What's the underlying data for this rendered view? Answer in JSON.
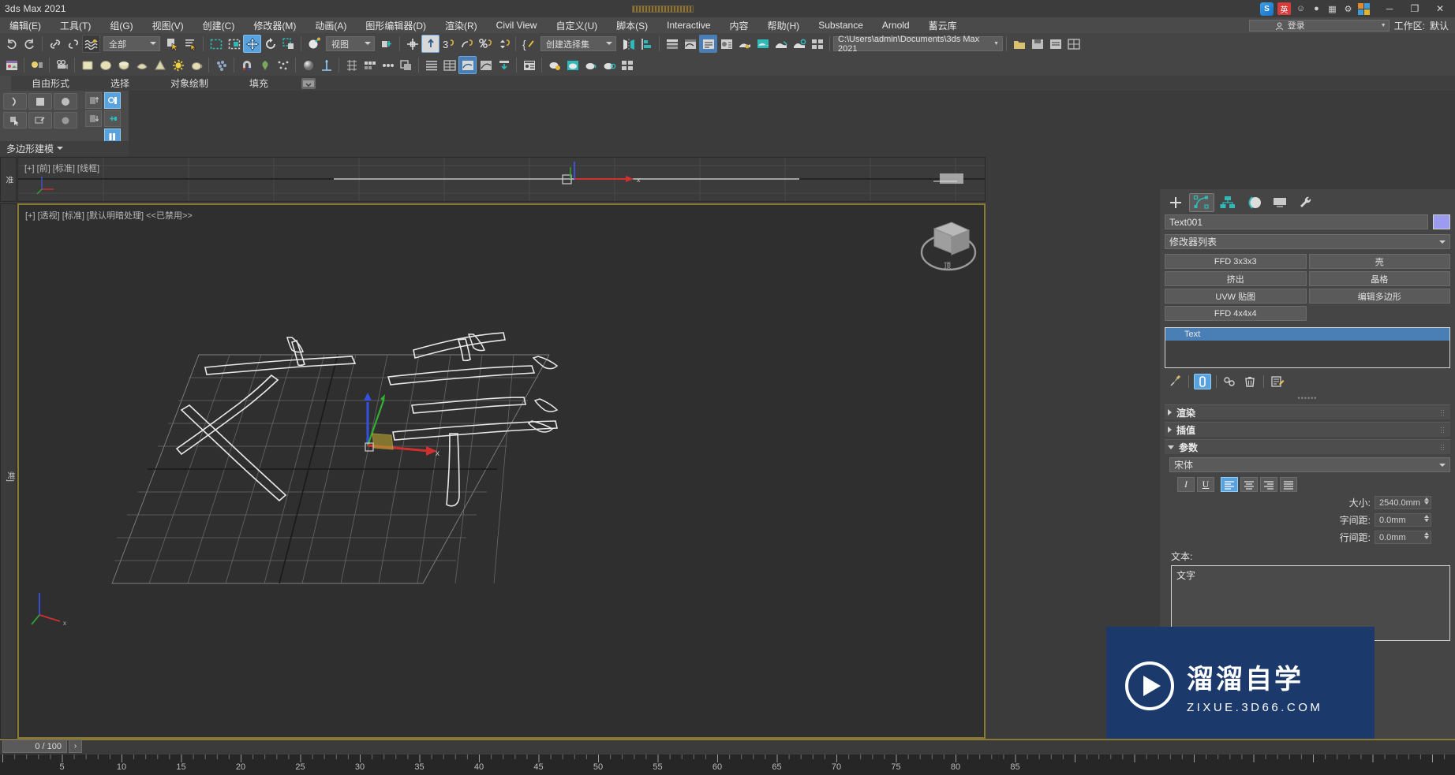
{
  "titlebar": {
    "app_title": "3ds Max 2021",
    "minimize": "─",
    "maximize": "❐",
    "close": "✕",
    "tray_logo": "S",
    "tray_ime": "英",
    "tray_icons": [
      "smiley-icon",
      "mic-icon",
      "keyboard-icon",
      "apps-grid-icon"
    ]
  },
  "menubar": {
    "items": [
      "编辑(E)",
      "工具(T)",
      "组(G)",
      "视图(V)",
      "创建(C)",
      "修改器(M)",
      "动画(A)",
      "图形编辑器(D)",
      "渲染(R)",
      "Civil View",
      "自定义(U)",
      "脚本(S)",
      "Interactive",
      "内容",
      "帮助(H)",
      "Substance",
      "Arnold",
      "蓄云库"
    ],
    "login_label": "登录",
    "workspace_label": "工作区:",
    "workspace_value": "默认"
  },
  "toolbar1": {
    "selection_filter": "全部",
    "reference_coord": "视图",
    "named_selection": "创建选择集",
    "project_path": "C:\\Users\\admin\\Documents\\3ds Max 2021",
    "icons": [
      "undo-icon",
      "redo-icon",
      "select-link-icon",
      "unlink-icon",
      "bind-space-warp-icon",
      "select-object-icon",
      "select-by-name-icon",
      "rect-selection-region-icon",
      "window-crossing-icon",
      "select-and-move-icon",
      "select-and-rotate-icon",
      "select-and-scale-icon",
      "placement-icon",
      "use-pivot-center-icon",
      "select-and-manipulate-icon",
      "snap-toggle-icon",
      "angle-snap-icon",
      "percent-snap-icon",
      "spinner-snap-icon",
      "edit-named-selection-icon",
      "mirror-icon",
      "align-icon",
      "layer-explorer-icon",
      "curve-editor-icon",
      "schematic-view-icon",
      "material-editor-icon",
      "render-setup-icon",
      "render-frame-window-icon",
      "render-production-icon",
      "render-iterative-icon",
      "activeshade-icon",
      "project-folder-icon"
    ]
  },
  "toolbar2": {
    "icons": [
      "asset-tracking-icon",
      "light-icon",
      "camera-icon",
      "box-icon",
      "sphere-icon",
      "cylinder-icon",
      "torus-icon",
      "cone-icon",
      "sunlight-icon",
      "teapot-icon",
      "scatter-icon",
      "particle-icon",
      "magnet-icon",
      "foliage-icon",
      "material-sphere-icon",
      "move-gizmo-icon",
      "align-grid-icon",
      "array-icon",
      "spacing-tool-icon",
      "clone-icon",
      "snapshot-icon",
      "list-view-icon",
      "table-view-icon",
      "graph-icon",
      "curve-icon",
      "export-icon",
      "import-icon",
      "dope-sheet-icon",
      "teapot-gear-icon",
      "teapot-cyan-icon",
      "teapot-plain-icon",
      "teapot-outline-icon",
      "quad-layout-icon"
    ]
  },
  "ribbon": {
    "tabs": [
      "自由形式",
      "选择",
      "对象绘制",
      "填充"
    ],
    "panel_title": "多边形建模",
    "panel_icons": [
      "arc-shape-icon",
      "square-shape-icon",
      "sphere-shape-icon",
      "cursor-select-icon",
      "object-paint-icon",
      "circle-icon",
      "push-up-icon",
      "push-down-icon",
      "highlight-icon",
      "pin-icon",
      "columns-icon"
    ]
  },
  "viewports": {
    "top_label": "[+] [前] [标准] [线框]",
    "main_label": "[+] [透视] [标准] [默认明暗处理] <<已禁用>>",
    "left_tab_top": "准",
    "left_tab_main": "准]",
    "viewcube_label": "顶"
  },
  "command_panel": {
    "tabs": [
      {
        "name": "create-tab",
        "icon": "plus-icon"
      },
      {
        "name": "modify-tab",
        "icon": "modify-icon"
      },
      {
        "name": "hierarchy-tab",
        "icon": "hierarchy-icon"
      },
      {
        "name": "motion-tab",
        "icon": "motion-icon"
      },
      {
        "name": "display-tab",
        "icon": "display-icon"
      },
      {
        "name": "utilities-tab",
        "icon": "wrench-icon"
      }
    ],
    "object_name": "Text001",
    "object_color": "#9b9bf0",
    "modifier_list_label": "修改器列表",
    "modifier_buttons": [
      "FFD 3x3x3",
      "壳",
      "挤出",
      "晶格",
      "UVW 贴图",
      "编辑多边形",
      "FFD 4x4x4"
    ],
    "stack_items": [
      "Text"
    ],
    "stack_tools": [
      "pin-stack-icon",
      "show-end-result-icon",
      "make-unique-icon",
      "remove-modifier-icon",
      "configure-sets-icon"
    ],
    "rollouts": [
      {
        "label": "渲染",
        "expanded": false
      },
      {
        "label": "插值",
        "expanded": false
      },
      {
        "label": "参数",
        "expanded": true
      }
    ],
    "parameters": {
      "font": "宋体",
      "style_buttons": [
        "I",
        "U"
      ],
      "align_buttons": [
        "align-left-icon",
        "align-center-icon",
        "align-right-icon",
        "align-justify-icon"
      ],
      "align_active": "align-left-icon",
      "size_label": "大小:",
      "size_value": "2540.0mm",
      "kerning_label": "字间距:",
      "kerning_value": "0.0mm",
      "leading_label": "行间距:",
      "leading_value": "0.0mm",
      "text_label": "文本:",
      "text_value": "文字"
    }
  },
  "watermark": {
    "title": "溜溜自学",
    "subtitle": "ZIXUE.3D66.COM",
    "accent": "#1b3a6b"
  },
  "timeline": {
    "frame_value": "0 / 100",
    "next_frame": "›",
    "tick_labels": [
      "5",
      "10",
      "15",
      "20",
      "25",
      "30",
      "35",
      "40",
      "45",
      "50",
      "55",
      "60",
      "65",
      "70",
      "75",
      "80",
      "85"
    ]
  }
}
